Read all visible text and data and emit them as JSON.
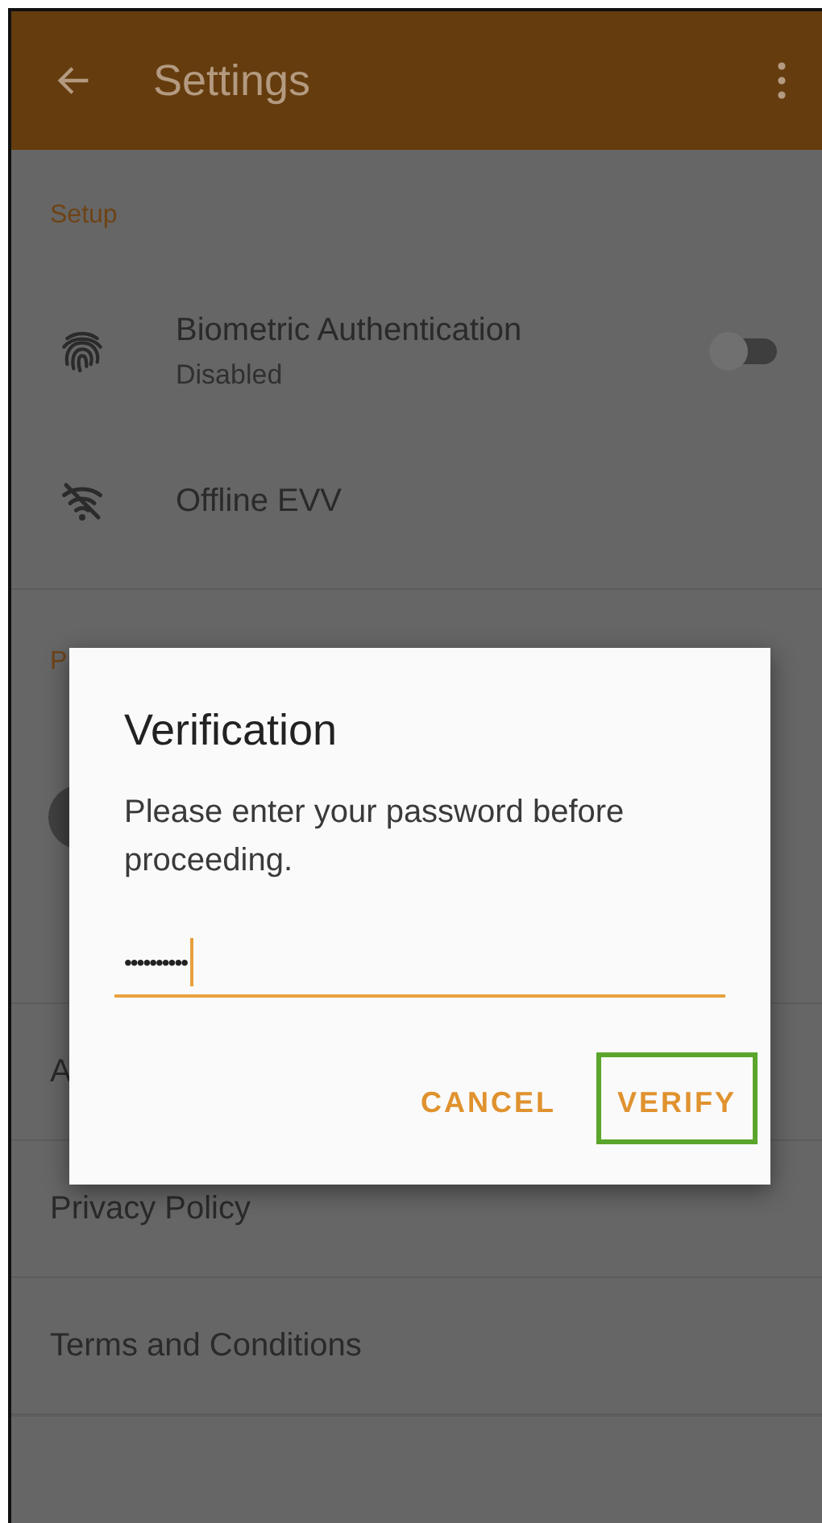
{
  "app_bar": {
    "title": "Settings"
  },
  "sections": [
    {
      "title": "Setup",
      "items": [
        {
          "kind": "switch",
          "label": "Biometric Authentication",
          "subtitle": "Disabled",
          "on": false
        },
        {
          "kind": "icon",
          "label": "Offline EVV"
        }
      ]
    },
    {
      "title": "P",
      "items": [
        {
          "kind": "avatar"
        }
      ]
    },
    {
      "items": [
        {
          "kind": "plain",
          "label": "A"
        },
        {
          "kind": "plain",
          "label": "Privacy Policy"
        },
        {
          "kind": "plain",
          "label": "Terms and Conditions"
        }
      ]
    }
  ],
  "dialog": {
    "title": "Verification",
    "message": "Please enter your password before proceeding.",
    "password": "••••••••••",
    "buttons": [
      {
        "label": "CANCEL",
        "highlighted": false
      },
      {
        "label": "VERIFY",
        "highlighted": true
      }
    ]
  }
}
